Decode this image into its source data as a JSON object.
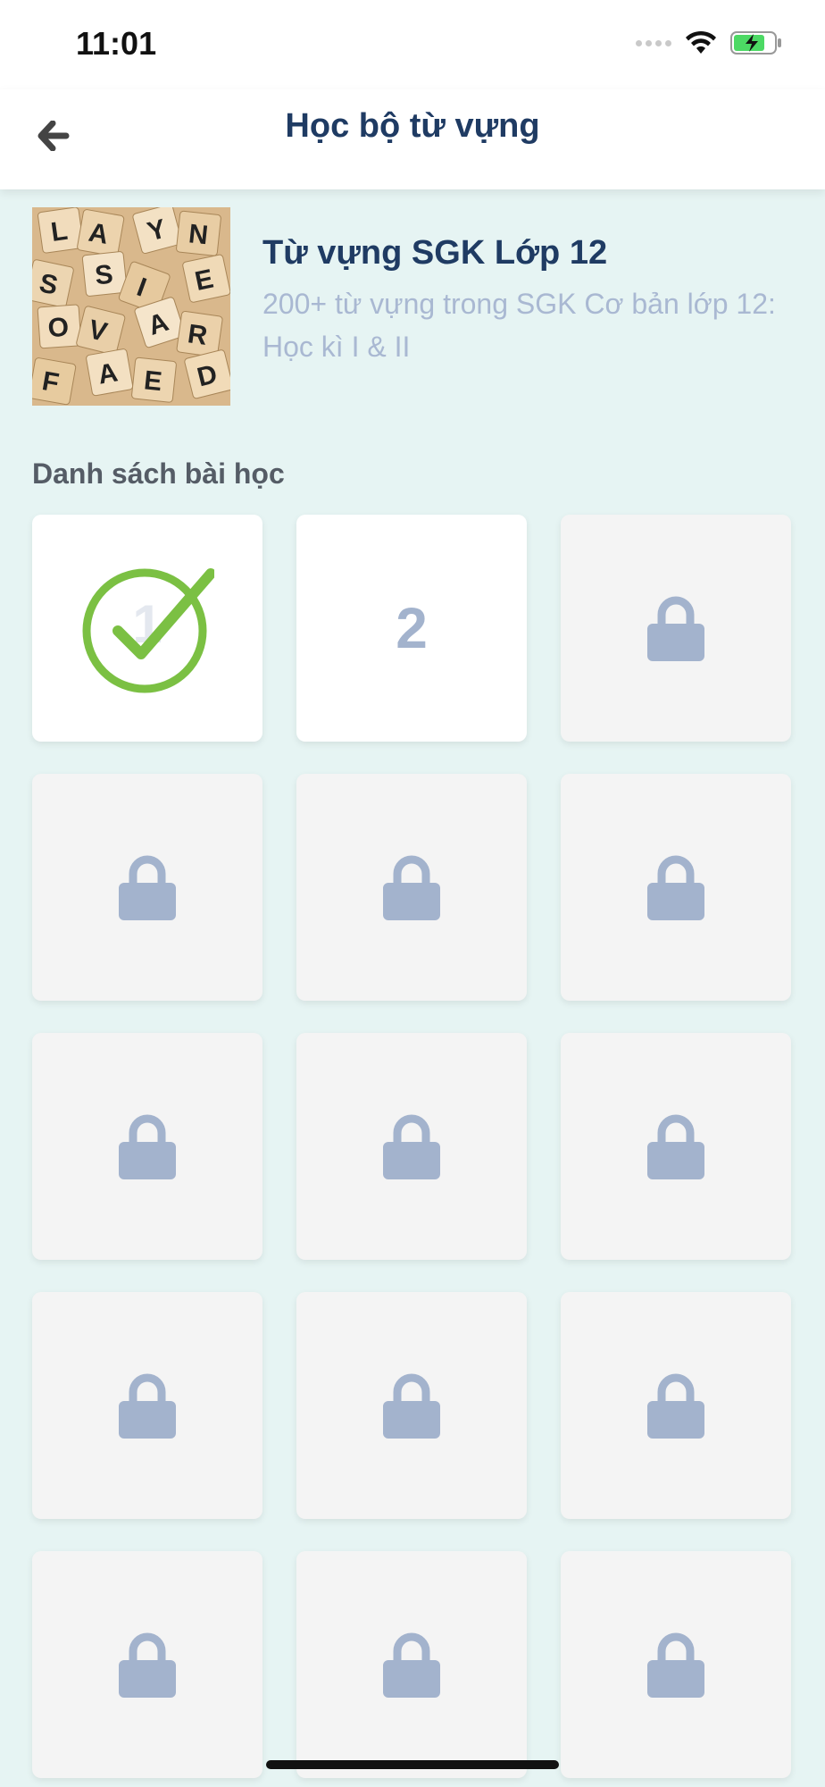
{
  "status_bar": {
    "time": "11:01",
    "icons": [
      "signal-dots-icon",
      "wifi-icon",
      "battery-charging-icon"
    ]
  },
  "nav": {
    "title": "Học bộ từ vựng",
    "back_icon": "arrow-left-icon"
  },
  "course": {
    "title": "Từ vựng SGK Lớp 12",
    "description": "200+ từ vựng trong SGK Cơ bản lớp 12: Học kì I & II",
    "thumbnail_icon": "scrabble-tiles-image"
  },
  "lessons_section": {
    "label": "Danh sách bài học"
  },
  "lessons": [
    {
      "number": "1",
      "state": "completed"
    },
    {
      "number": "2",
      "state": "unlocked"
    },
    {
      "number": "",
      "state": "locked"
    },
    {
      "number": "",
      "state": "locked"
    },
    {
      "number": "",
      "state": "locked"
    },
    {
      "number": "",
      "state": "locked"
    },
    {
      "number": "",
      "state": "locked"
    },
    {
      "number": "",
      "state": "locked"
    },
    {
      "number": "",
      "state": "locked"
    },
    {
      "number": "",
      "state": "locked"
    },
    {
      "number": "",
      "state": "locked"
    },
    {
      "number": "",
      "state": "locked"
    },
    {
      "number": "",
      "state": "locked"
    },
    {
      "number": "",
      "state": "locked"
    },
    {
      "number": "",
      "state": "locked"
    }
  ],
  "colors": {
    "background": "#e6f4f3",
    "title": "#1f3b63",
    "muted": "#a9b8d2",
    "lock": "#a3b3cd",
    "check": "#7bc043",
    "battery": "#4cd964"
  }
}
